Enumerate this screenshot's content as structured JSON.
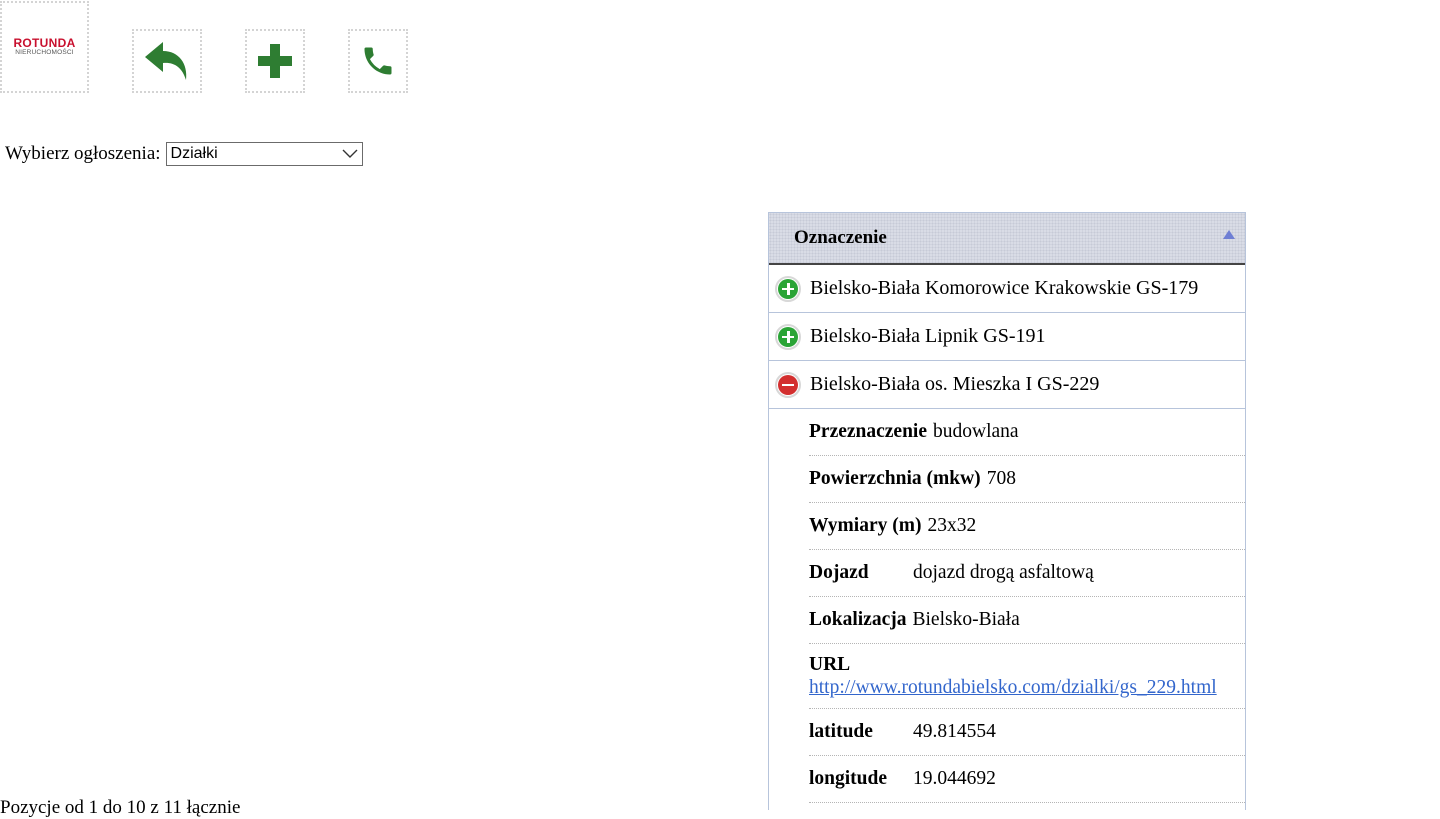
{
  "toolbar": {
    "logo": {
      "line1": "ROTUNDA",
      "line2": "NIERUCHOMOŚCI"
    },
    "buttons": [
      {
        "name": "back",
        "icon": "undo-arrow-icon"
      },
      {
        "name": "add",
        "icon": "plus-icon"
      },
      {
        "name": "call",
        "icon": "phone-icon"
      }
    ],
    "icon_color": "#2e7d32"
  },
  "selector": {
    "label": "Wybierz ogłoszenia:",
    "selected": "Działki"
  },
  "list": {
    "header": "Oznaczenie",
    "rows": [
      {
        "title": "Bielsko-Biała Komorowice Krakowskie GS-179",
        "state": "collapsed"
      },
      {
        "title": "Bielsko-Biała Lipnik GS-191",
        "state": "collapsed"
      },
      {
        "title": "Bielsko-Biała os. Mieszka I GS-229",
        "state": "expanded"
      }
    ],
    "details": {
      "przeznaczenie": {
        "label": "Przeznaczenie",
        "value": "budowlana"
      },
      "powierzchnia": {
        "label": "Powierzchnia (mkw)",
        "value": "708"
      },
      "wymiary": {
        "label": "Wymiary (m)",
        "value": "23x32"
      },
      "dojazd": {
        "label": "Dojazd",
        "value": "dojazd drogą asfaltową"
      },
      "lokalizacja": {
        "label": "Lokalizacja",
        "value": "Bielsko-Biała"
      },
      "url": {
        "label": "URL",
        "value": "http://www.rotundabielsko.com/dzialki/gs_229.html"
      },
      "latitude": {
        "label": "latitude",
        "value": "49.814554"
      },
      "longitude": {
        "label": "longitude",
        "value": "19.044692"
      }
    }
  },
  "colors": {
    "expand": "#2aa436",
    "collapse": "#d32f2f",
    "link": "#3366cc"
  },
  "footer": {
    "page_info": "Pozycje od 1 do 10 z 11 łącznie"
  }
}
